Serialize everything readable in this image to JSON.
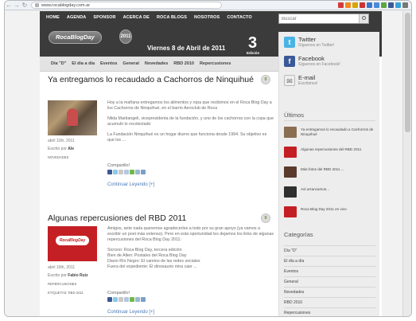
{
  "browser": {
    "back": "←",
    "forward": "→",
    "reload": "↻",
    "url": "www.rocablogday.com.ar",
    "ext_icons": [
      {
        "name": "adblock-icon",
        "color": "#d43a3a"
      },
      {
        "name": "rss-icon",
        "color": "#f28a1d"
      },
      {
        "name": "star-icon",
        "color": "#d9a400"
      },
      {
        "name": "gmail-icon",
        "color": "#c33"
      },
      {
        "name": "docs-icon",
        "color": "#3a77c9"
      },
      {
        "name": "calendar-icon",
        "color": "#4a8ad8"
      },
      {
        "name": "evernote-icon",
        "color": "#5aa641"
      },
      {
        "name": "facebook-icon",
        "color": "#3b5998"
      },
      {
        "name": "twitter-icon",
        "color": "#38a1d8"
      },
      {
        "name": "wrench-icon",
        "color": "#777"
      }
    ]
  },
  "header": {
    "nav": [
      "HOME",
      "AGENDA",
      "SPONSOR",
      "ACERCA DE",
      "ROCA BLOGS",
      "NOSOTROS",
      "CONTACTO"
    ],
    "search_placeholder": "Buscar",
    "logo_text": "RocaBlogDay",
    "logo_badge": "2011",
    "date": "Viernes 8 de Abril de 2011",
    "edition_number": "3",
    "edition_label": "Edición"
  },
  "categories": [
    "Día \"D\"",
    "El día a día",
    "Eventos",
    "General",
    "Novedades",
    "RBD 2010",
    "Repercusiones"
  ],
  "posts": [
    {
      "title": "Ya entregamos lo recaudado a Cachorros de Ninquihué",
      "comment_count": "0",
      "date": "abril 11th, 2011",
      "author_prefix": "Escrito por",
      "author": "Ale",
      "tags": "NOVEDADES",
      "paragraphs": [
        "Hoy a la mañana entregamos los alimentos y ropa que recibimos en el Roca Blog Day a los Cachorros de Ninquihué, en el barrio Aeroclub de Roca",
        "Nilda Martiangeli, vicepresidenta de la fundación, y uno de los cachorros con la copa que acumuló lo recolectado",
        "La Fundación Ninquihué es un hogar diurno que funciona desde 1994. Su objetivo es que los ..."
      ],
      "share_label": "Compartilo!",
      "continue_label": "Continuar Leyendo [+]"
    },
    {
      "title": "Algunas repercusiones del RBD 2011",
      "comment_count": "0",
      "date": "abril 10th, 2011",
      "author_prefix": "Escrito por",
      "author": "Fabio Ruiz",
      "tags": "REPERCUSIONES",
      "tags2": "ETIQUETAS: RBD 2011",
      "thumb_text": "RocaBlogDay",
      "paragraphs": [
        "Amigos, ante nada queremos agradecerles a todo por su gran apoyo (ya vamos a escribir un post más extenso). Pero en esta oportunidad les dejamos los links de algunas repercusiones del Roca Blog Day 2011:",
        "Sicrono: Roca Blog Day, tercera edición\nBien de Allen: Postales del Roca Blog Day\nDiario Río Negro: El camino de las redes sociales\nFuera del expediente: El dinosaurio mira caer ..."
      ],
      "share_label": "Compartilo!",
      "continue_label": "Continuar Leyendo [+]"
    }
  ],
  "sidebar": {
    "social": [
      {
        "name": "Twitter",
        "sub": "Síguenos en Twitter!",
        "glyph": "t",
        "color": "#4ab3e5"
      },
      {
        "name": "Facebook",
        "sub": "Síguenos en Facebook!",
        "glyph": "f",
        "color": "#3b5998"
      },
      {
        "name": "E-mail",
        "sub": "Escribinos!",
        "glyph": "✉",
        "color": "#eeeeee"
      }
    ],
    "recent_heading": "Últimos",
    "recent": [
      {
        "text": "Ya entregamos lo recaudado a Cachorros de Ninquihué",
        "color": "#8a6e52"
      },
      {
        "text": "Algunas repercusiones del RBD 2011",
        "color": "#c41f24"
      },
      {
        "text": "Más fotos del RBD 2011 ...",
        "color": "#5a3b2c"
      },
      {
        "text": "Así arrancamos...",
        "color": "#2f2f2f"
      },
      {
        "text": "Roca Blog Day 2011 en vivo",
        "color": "#c41f24"
      }
    ],
    "categories_heading": "Categorías",
    "categories": [
      "Día \"D\"",
      "El día a día",
      "Eventos",
      "General",
      "Novedades",
      "RBD 2010",
      "Repercusiones"
    ]
  }
}
